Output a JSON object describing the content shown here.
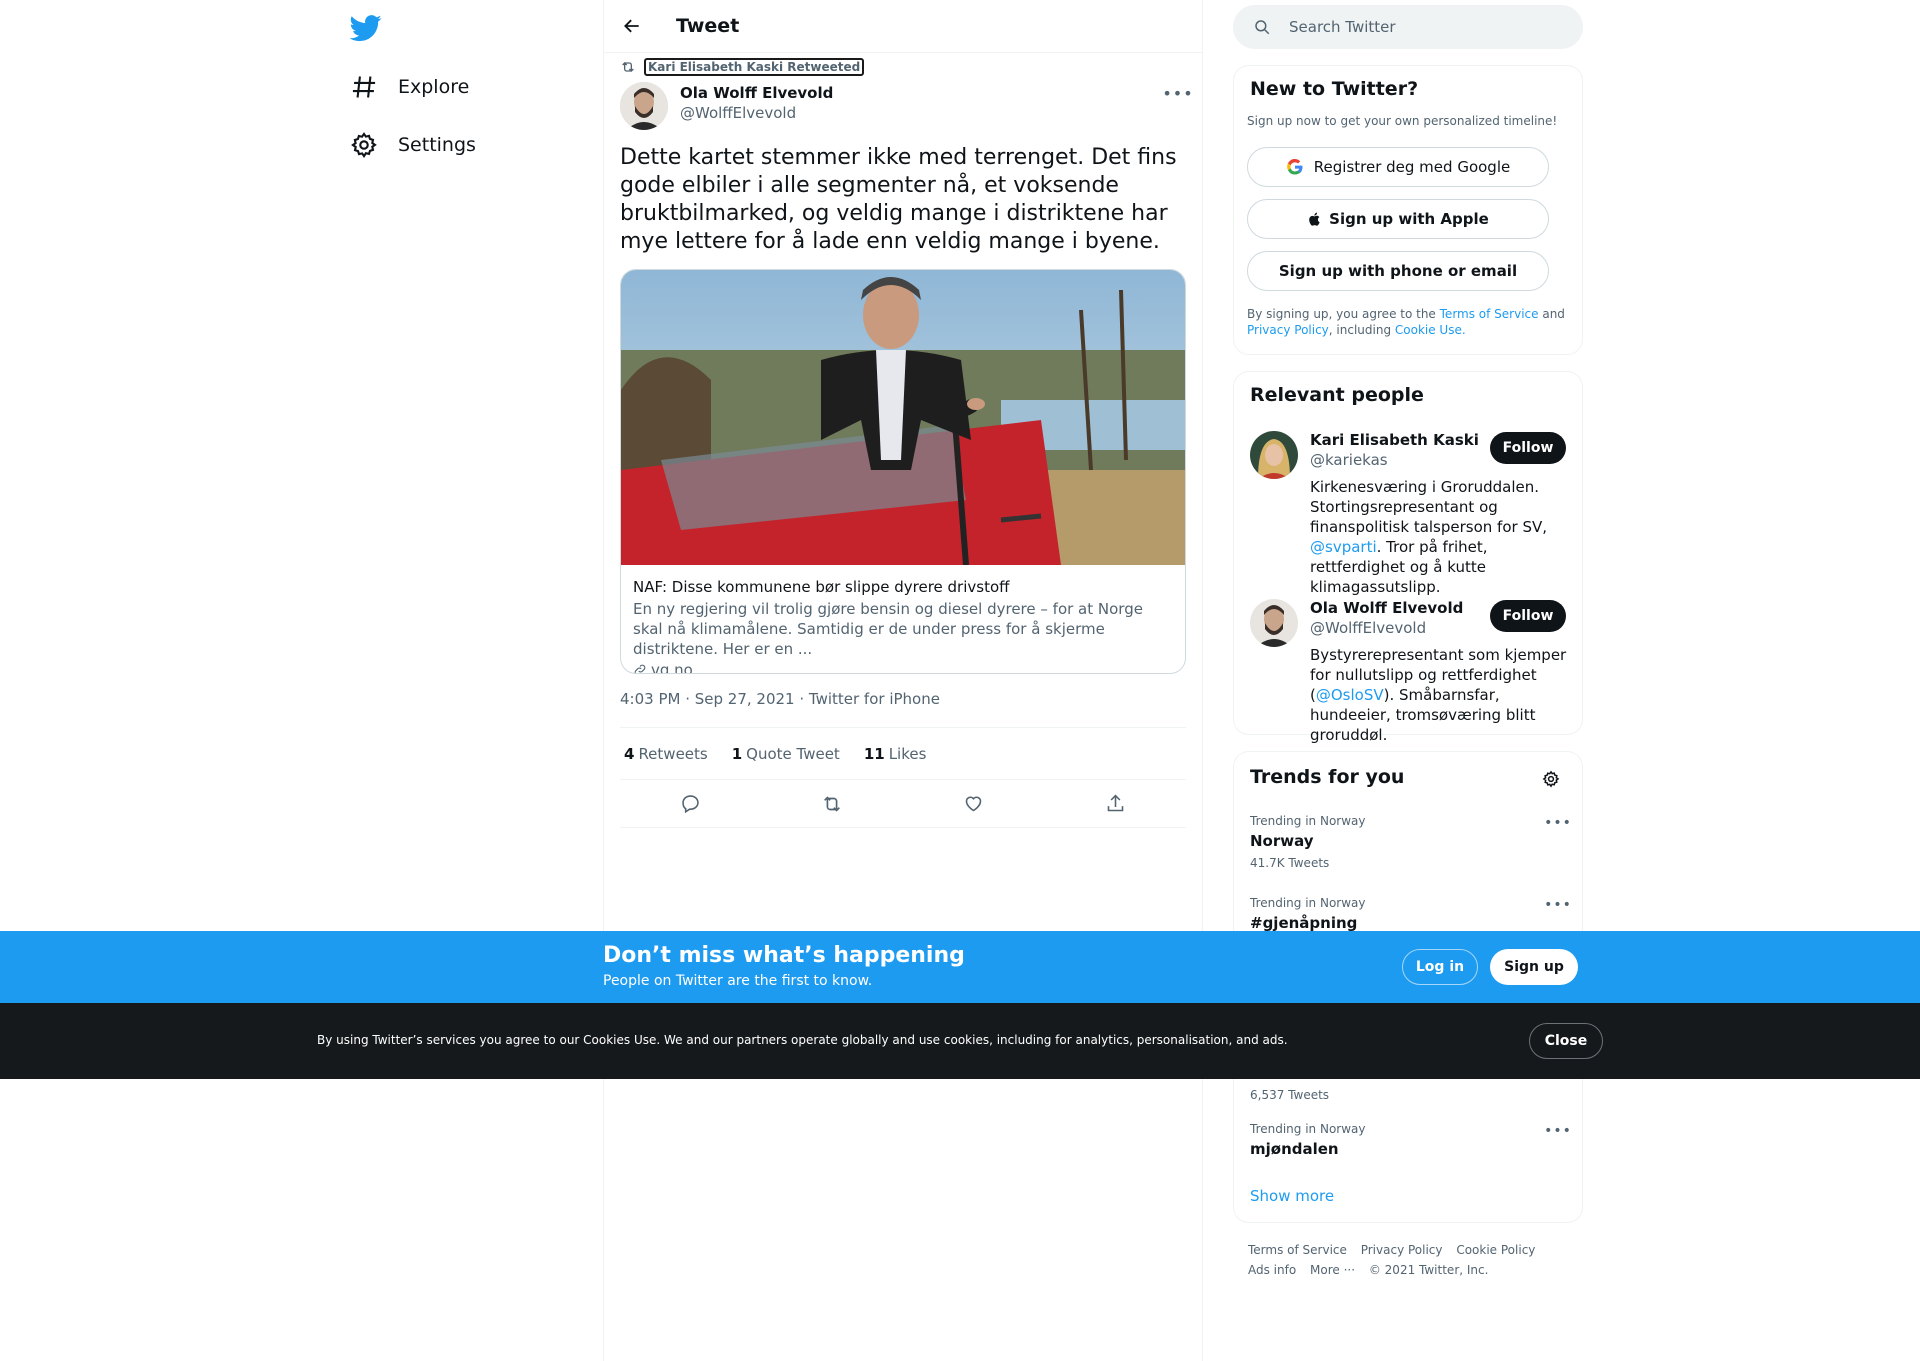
{
  "nav": {
    "items": [
      {
        "label": "Explore",
        "icon": "hashtag-icon"
      },
      {
        "label": "Settings",
        "icon": "gear-icon"
      }
    ]
  },
  "header": {
    "title": "Tweet"
  },
  "tweet": {
    "retweeted_by": "Kari Elisabeth Kaski Retweeted",
    "author_name": "Ola Wolff Elvevold",
    "author_handle": "@WolffElvevold",
    "text": "Dette kartet stemmer ikke med terrenget. Det fins gode elbiler i alle segmenter nå, et voksende bruktbilmarked, og veldig mange i distriktene har mye lettere for å lade enn veldig mange i byene.",
    "card": {
      "title": "NAF: Disse kommunene bør slippe dyrere drivstoff",
      "description": "En ny regjering vil trolig gjøre bensin og diesel dyrere – for at Norge skal nå klimamålene. Samtidig er de under press for å skjerme distriktene. Her er en ...",
      "domain": "vg.no"
    },
    "meta": "4:03 PM · Sep 27, 2021 · Twitter for iPhone",
    "stats": {
      "retweets_count": "4",
      "retweets_label": "Retweets",
      "quotes_count": "1",
      "quotes_label": "Quote Tweet",
      "likes_count": "11",
      "likes_label": "Likes"
    }
  },
  "search": {
    "placeholder": "Search Twitter"
  },
  "new_to_twitter": {
    "title": "New to Twitter?",
    "subtitle": "Sign up now to get your own personalized timeline!",
    "google_label": "Registrer deg med Google",
    "apple_label": "Sign up with Apple",
    "phone_label": "Sign up with phone or email",
    "legal_pre": "By signing up, you agree to the ",
    "legal_tos": "Terms of Service",
    "legal_and": " and ",
    "legal_privacy": "Privacy Policy",
    "legal_including": ", including ",
    "legal_cookie": "Cookie Use."
  },
  "relevant_people": {
    "title": "Relevant people",
    "follow_label": "Follow",
    "people": [
      {
        "name": "Kari Elisabeth Kaski",
        "handle": "@kariekas",
        "bio_pre": "Kirkenesværing i Groruddalen. Stortingsrepresentant og finanspolitisk talsperson for SV, ",
        "bio_link": "@svparti",
        "bio_post": ". Tror på frihet, rettferdighet og å kutte klimagassutslipp."
      },
      {
        "name": "Ola Wolff Elvevold",
        "handle": "@WolffElvevold",
        "bio_pre": "Bystyrerepresentant som kjemper for nullutslipp og rettferdighet (",
        "bio_link": "@OsloSV",
        "bio_post": "). Småbarnsfar, hundeeier, tromsøværing blitt groruddøl."
      }
    ]
  },
  "trends": {
    "title": "Trends for you",
    "items": [
      {
        "context": "Trending in Norway",
        "name": "Norway",
        "count": "41.7K Tweets"
      },
      {
        "context": "Trending in Norway",
        "name": "#gjenåpning",
        "count": ""
      },
      {
        "context": "",
        "name": "",
        "count": "6,537 Tweets"
      },
      {
        "context": "Trending in Norway",
        "name": "mjøndalen",
        "count": ""
      }
    ],
    "show_more": "Show more"
  },
  "footer": {
    "links": [
      "Terms of Service",
      "Privacy Policy",
      "Cookie Policy",
      "Ads info",
      "More ···",
      "© 2021 Twitter, Inc."
    ]
  },
  "banner": {
    "headline": "Don’t miss what’s happening",
    "subline": "People on Twitter are the first to know.",
    "login_label": "Log in",
    "signup_label": "Sign up"
  },
  "cookie_bar": {
    "text": "By using Twitter’s services you agree to our Cookies Use. We and our partners operate globally and use cookies, including for analytics, personalisation, and ads.",
    "close_label": "Close"
  },
  "colors": {
    "accent": "#1d9bf0",
    "text": "#0f1419",
    "secondary": "#536471",
    "cookie_bg": "#16191c"
  }
}
